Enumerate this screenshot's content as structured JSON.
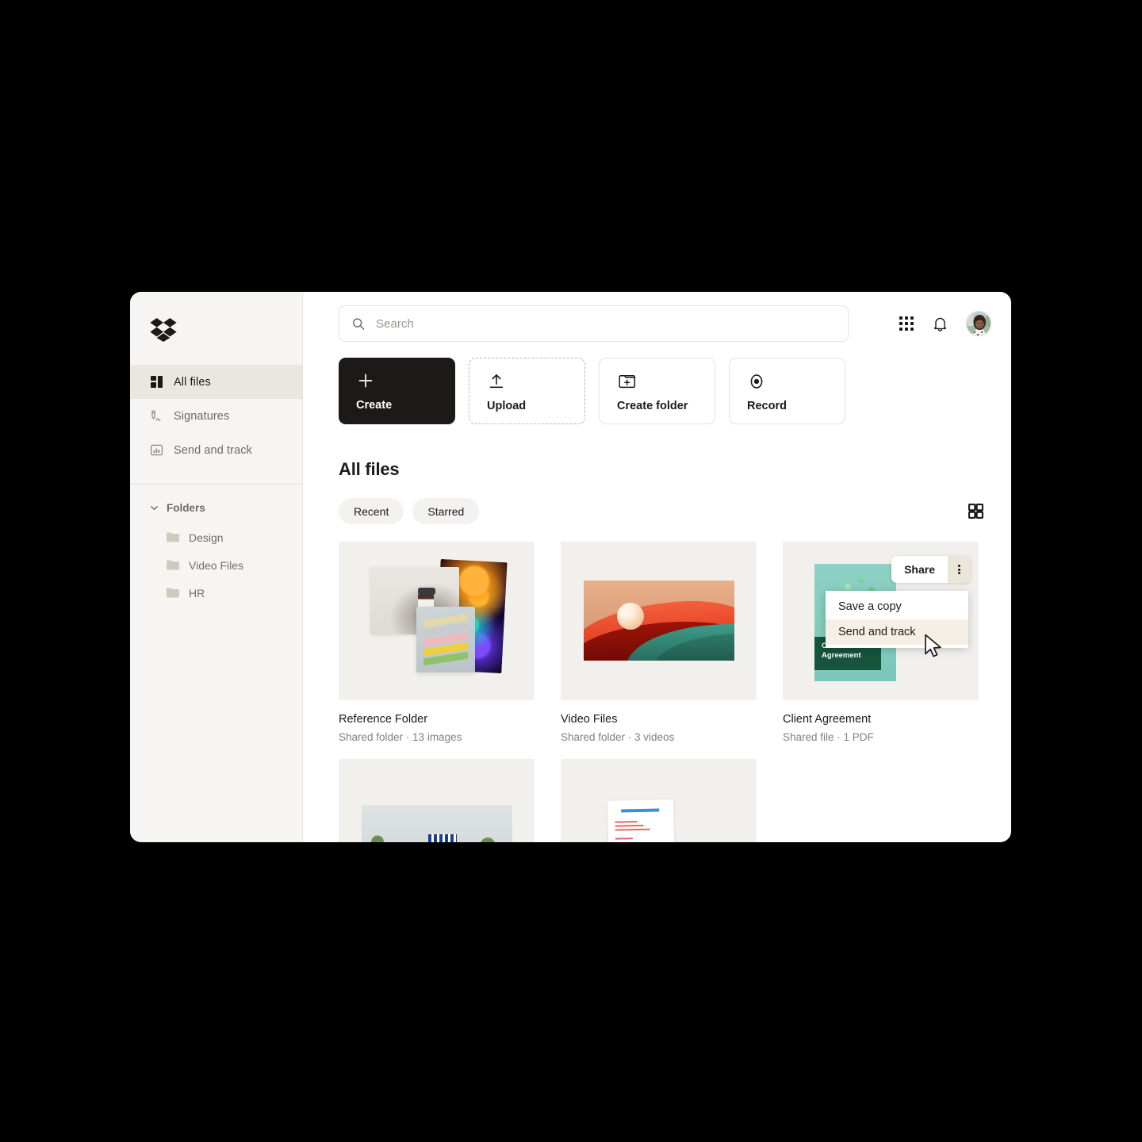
{
  "app": {
    "name": "Dropbox",
    "logo_icon": "dropbox-logo"
  },
  "sidebar": {
    "items": [
      {
        "label": "All files",
        "icon": "all-files-icon",
        "active": true
      },
      {
        "label": "Signatures",
        "icon": "signature-pen-icon",
        "active": false
      },
      {
        "label": "Send and track",
        "icon": "send-and-track-chart-icon",
        "active": false
      }
    ],
    "folders_section": {
      "title": "Folders",
      "caret_icon": "chevron-down-icon",
      "items": [
        {
          "label": "Design",
          "icon": "folder-icon"
        },
        {
          "label": "Video Files",
          "icon": "folder-icon"
        },
        {
          "label": "HR",
          "icon": "folder-icon"
        }
      ]
    }
  },
  "header": {
    "search": {
      "placeholder": "Search",
      "value": "",
      "icon": "search-icon"
    },
    "apps_icon": "grid-apps-icon",
    "notifications_icon": "bell-icon",
    "avatar_icon": "avatar"
  },
  "actions": [
    {
      "label": "Create",
      "icon": "plus-icon",
      "style": "primary"
    },
    {
      "label": "Upload",
      "icon": "upload-arrow-icon",
      "style": "dashed"
    },
    {
      "label": "Create folder",
      "icon": "folder-plus-icon",
      "style": "solid"
    },
    {
      "label": "Record",
      "icon": "record-circle-icon",
      "style": "solid"
    }
  ],
  "main": {
    "section_title": "All files",
    "filters": [
      {
        "label": "Recent"
      },
      {
        "label": "Starred"
      }
    ],
    "view_toggle_icon": "grid-view-icon"
  },
  "files": [
    {
      "name": "Reference Folder",
      "meta": "Shared folder · 13 images",
      "thumb": "photo-collage"
    },
    {
      "name": "Video Files",
      "meta": "Shared folder · 3 videos",
      "thumb": "abstract-wave-video"
    },
    {
      "name": "Client Agreement",
      "meta": "Shared file · 1 PDF",
      "thumb": "client-agreement-pdf",
      "thumb_label": "Client Agreement"
    },
    {
      "name": "",
      "meta": "",
      "thumb": "architecture-photo"
    },
    {
      "name": "",
      "meta": "",
      "thumb": "document-preview"
    }
  ],
  "overlay": {
    "share_label": "Share",
    "kebab_icon": "more-options-icon",
    "menu": [
      {
        "label": "Save a copy",
        "hovered": false
      },
      {
        "label": "Send and track",
        "hovered": true
      }
    ],
    "cursor_icon": "mouse-pointer-icon"
  },
  "colors": {
    "background": "#000000",
    "window": "#ffffff",
    "sidebar": "#f7f5f2",
    "sidebar_active": "#eae7e1",
    "primary_button": "#1e1919",
    "chip": "#f4f2ef",
    "thumb_bg": "#f2f0ec",
    "menu_hover": "#f5efe6",
    "kebab_bg": "#ece6da"
  }
}
